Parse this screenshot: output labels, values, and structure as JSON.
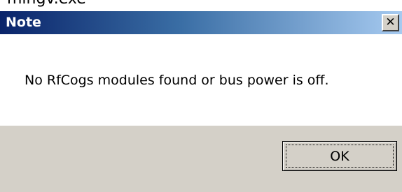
{
  "top_strip": {
    "partial_text": "mingv.exe"
  },
  "dialog": {
    "title": "Note",
    "close_glyph": "✕",
    "message": "No RfCogs modules found or bus power is off.",
    "ok_label": "OK"
  },
  "colors": {
    "titlebar_start": "#0a246a",
    "titlebar_end": "#a6caf0",
    "face": "#d4d0c8",
    "content_bg": "#ffffff"
  }
}
